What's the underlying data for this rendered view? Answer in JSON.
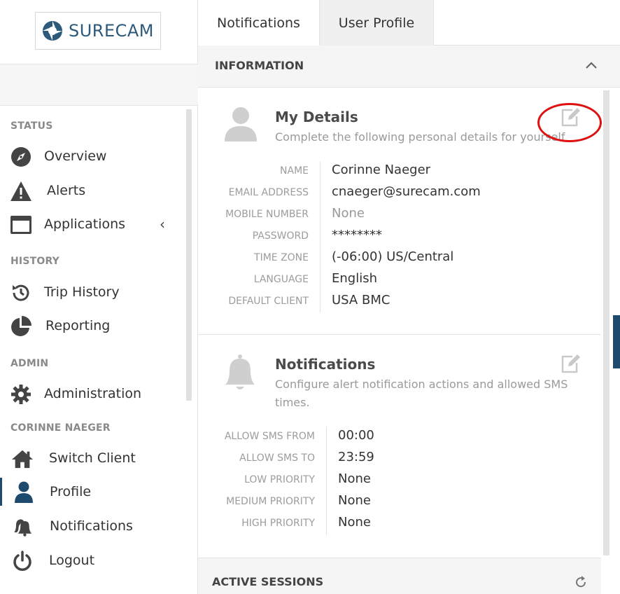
{
  "brand": {
    "name": "SURECAM",
    "color": "#2d5a7b"
  },
  "sidebar": {
    "sections": {
      "status": "STATUS",
      "history": "HISTORY",
      "admin": "ADMIN",
      "user": "CORINNE NAEGER"
    },
    "items": [
      {
        "label": "Overview",
        "icon": "compass-icon"
      },
      {
        "label": "Alerts",
        "icon": "warning-icon"
      },
      {
        "label": "Applications",
        "icon": "window-icon",
        "chevron": "‹"
      },
      {
        "label": "Trip History",
        "icon": "history-icon"
      },
      {
        "label": "Reporting",
        "icon": "pie-chart-icon"
      },
      {
        "label": "Administration",
        "icon": "gear-icon"
      },
      {
        "label": "Switch Client",
        "icon": "home-icon"
      },
      {
        "label": "Profile",
        "icon": "user-icon",
        "active": true
      },
      {
        "label": "Notifications",
        "icon": "bells-icon"
      },
      {
        "label": "Logout",
        "icon": "power-icon"
      }
    ]
  },
  "tabs": [
    {
      "label": "Notifications"
    },
    {
      "label": "User Profile",
      "active": true
    }
  ],
  "information": {
    "title": "INFORMATION"
  },
  "my_details": {
    "title": "My Details",
    "description": "Complete the following personal details for yourself",
    "fields": [
      {
        "label": "NAME",
        "value": "Corinne Naeger"
      },
      {
        "label": "EMAIL ADDRESS",
        "value": "cnaeger@surecam.com"
      },
      {
        "label": "MOBILE NUMBER",
        "value": "None"
      },
      {
        "label": "PASSWORD",
        "value": "********"
      },
      {
        "label": "TIME ZONE",
        "value": "(-06:00) US/Central"
      },
      {
        "label": "LANGUAGE",
        "value": "English"
      },
      {
        "label": "DEFAULT CLIENT",
        "value": "USA BMC"
      }
    ]
  },
  "notifications_card": {
    "title": "Notifications",
    "description_line1": "Configure alert notification actions and allowed SMS",
    "description_line2": "times.",
    "fields": [
      {
        "label": "ALLOW SMS FROM",
        "value": "00:00"
      },
      {
        "label": "ALLOW SMS TO",
        "value": "23:59"
      },
      {
        "label": "LOW PRIORITY",
        "value": "None"
      },
      {
        "label": "MEDIUM PRIORITY",
        "value": "None"
      },
      {
        "label": "HIGH PRIORITY",
        "value": "None"
      }
    ]
  },
  "active_sessions": {
    "title": "ACTIVE SESSIONS"
  },
  "colors": {
    "accent": "#1e4a6e",
    "annotation": "#e01010",
    "icon_gray": "#cfcfcf"
  }
}
